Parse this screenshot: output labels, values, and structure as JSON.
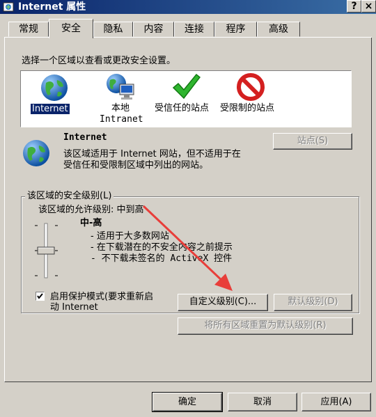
{
  "window": {
    "title": "Internet 属性",
    "help_glyph": "?",
    "close_glyph": "×"
  },
  "tabs": [
    "常规",
    "安全",
    "隐私",
    "内容",
    "连接",
    "程序",
    "高级"
  ],
  "zones": {
    "prompt": "选择一个区域以查看或更改安全设置。",
    "items": [
      {
        "label": "Internet",
        "icon": "globe-icon"
      },
      {
        "label": "本地",
        "label2": "Intranet",
        "icon": "intranet-icon"
      },
      {
        "label": "受信任的站点",
        "icon": "checkmark-icon"
      },
      {
        "label": "受限制的站点",
        "icon": "restricted-icon"
      }
    ]
  },
  "zone_info": {
    "name": "Internet",
    "description_line1": "该区域适用于 Internet 网站，但不适用于在",
    "description_line2": "受信任和受限制区域中列出的网站。",
    "sites_button": "站点(S)"
  },
  "security_level": {
    "group_title": "该区域的安全级别(L)",
    "allowed": "该区域的允许级别: 中到高",
    "level_name": "中-高",
    "bullets": [
      "- 适用于大多数网站",
      "- 在下载潜在的不安全内容之前提示",
      "- 不下载未签名的 ActiveX 控件"
    ],
    "slider_fraction": 0.5,
    "protected_mode_line1": "启用保护模式(要求重新启",
    "protected_mode_line2": "动 Internet",
    "protected_mode_checked": true,
    "custom_button": "自定义级别(C)...",
    "default_button": "默认级别(D)",
    "reset_all_button": "将所有区域重置为默认级别(R)"
  },
  "footer": {
    "ok": "确定",
    "cancel": "取消",
    "apply": "应用(A)"
  },
  "colors": {
    "titlebar": "#0a246a",
    "arrow": "#e83e3a",
    "face": "#d4d0c8"
  }
}
